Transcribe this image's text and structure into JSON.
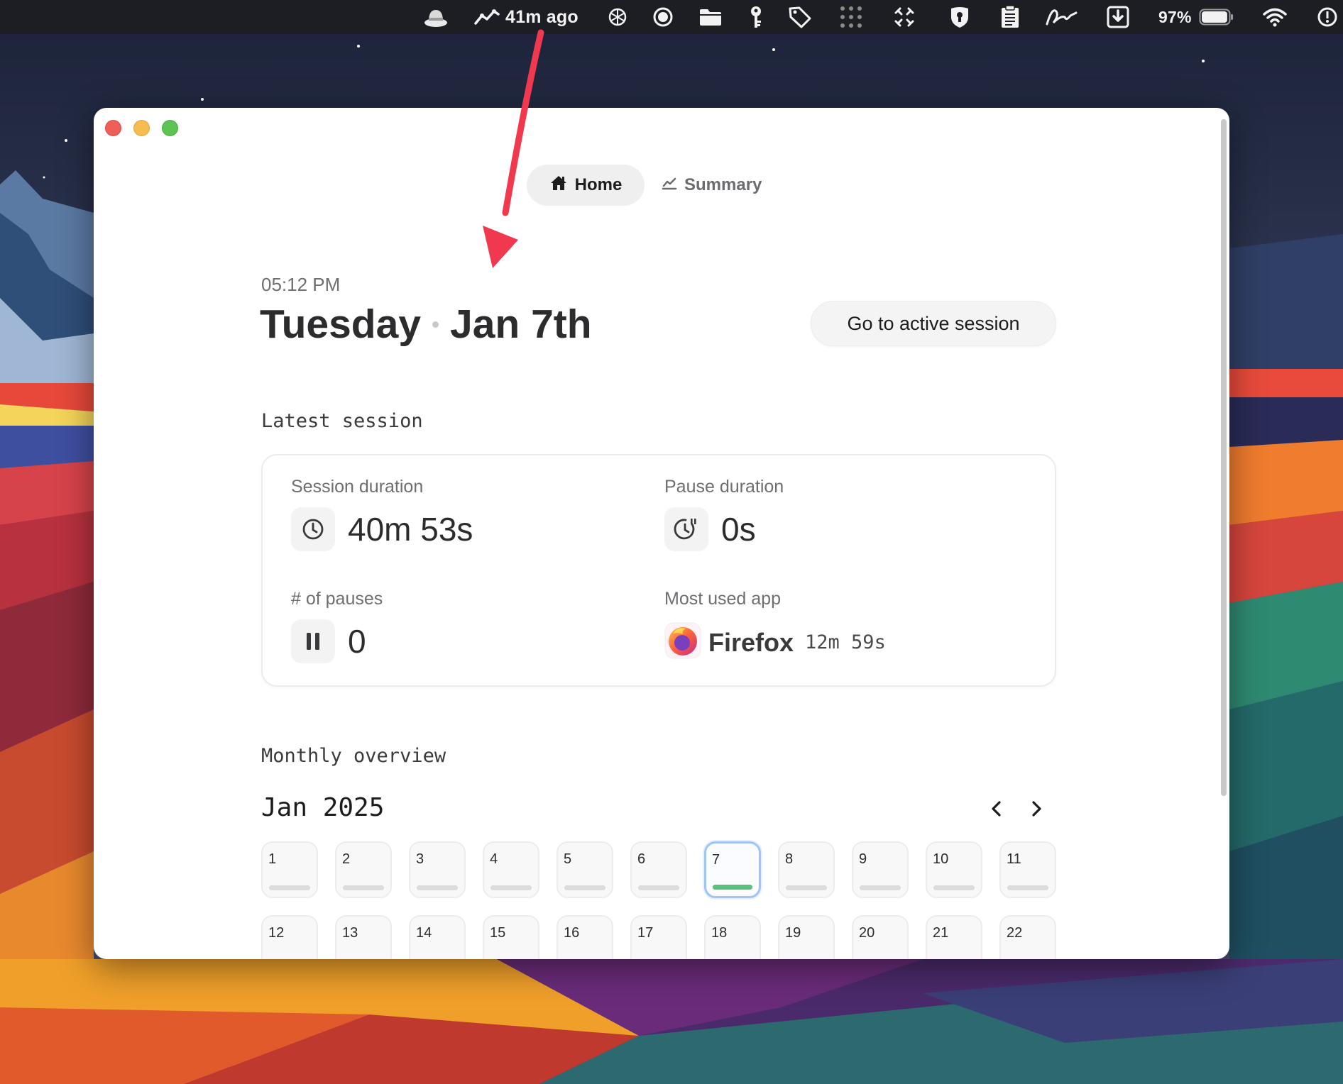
{
  "menubar": {
    "activity_text": "41m ago",
    "battery_percent": "97%",
    "battery_level": 0.97,
    "icons": [
      "hat-icon",
      "activity-icon",
      "openai-icon",
      "record-icon",
      "folder-icon",
      "key-icon",
      "tag-icon",
      "grid-icon",
      "expand-icon",
      "shield-icon",
      "clipboard-icon",
      "signature-icon",
      "download-icon",
      "battery-icon",
      "wifi-icon",
      "alert-icon"
    ]
  },
  "window": {
    "tabs": {
      "home": "Home",
      "summary": "Summary"
    },
    "time": "05:12 PM",
    "weekday": "Tuesday",
    "date": "Jan 7th",
    "active_session_button": "Go to active session",
    "latest_session": {
      "title": "Latest session",
      "session_duration_label": "Session duration",
      "session_duration_value": "40m 53s",
      "pause_duration_label": "Pause duration",
      "pause_duration_value": "0s",
      "pauses_label": "# of pauses",
      "pauses_value": "0",
      "most_used_app_label": "Most used app",
      "most_used_app_name": "Firefox",
      "most_used_app_time": "12m 59s"
    },
    "monthly_overview": {
      "title": "Monthly overview",
      "month": "Jan 2025",
      "selected_day": "7",
      "days": [
        "1",
        "2",
        "3",
        "4",
        "5",
        "6",
        "7",
        "8",
        "9",
        "10",
        "11",
        "12",
        "13",
        "14",
        "15",
        "16",
        "17",
        "18",
        "19",
        "20",
        "21",
        "22"
      ]
    }
  },
  "colors": {
    "accent_bar": "#57c17a",
    "selected_border": "#9fc4f5",
    "annotation_arrow": "#f0394f"
  }
}
